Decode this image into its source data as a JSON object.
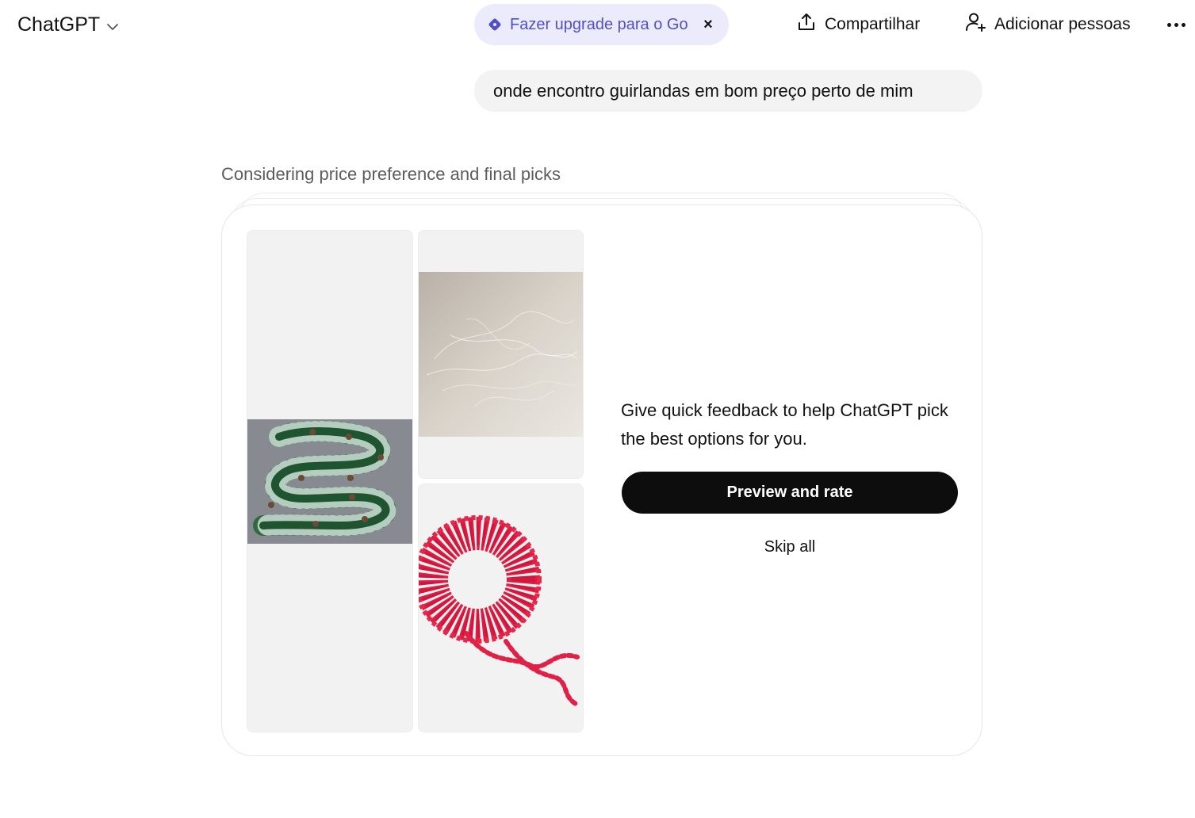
{
  "header": {
    "model_label": "ChatGPT",
    "upgrade_label": "Fazer upgrade para o Go",
    "upgrade_close": "×",
    "share_label": "Compartilhar",
    "add_people_label": "Adicionar pessoas"
  },
  "conversation": {
    "user_message": "onde encontro guirlandas em bom preço perto de mim",
    "thinking_label": "Considering price preference and final picks"
  },
  "feedback_card": {
    "message": "Give quick feedback to help ChatGPT pick the best options for you.",
    "preview_button": "Preview and rate",
    "skip_button": "Skip all",
    "images": [
      {
        "icon": "pine-garland-photo"
      },
      {
        "icon": "silver-tinsel-photo"
      },
      {
        "icon": "red-bead-garland-photo"
      }
    ]
  },
  "colors": {
    "upgrade_accent": "#5150c8",
    "upgrade_bg": "#ebebfb",
    "bubble_bg": "#f3f3f3",
    "primary_button": "#0d0d0d"
  }
}
